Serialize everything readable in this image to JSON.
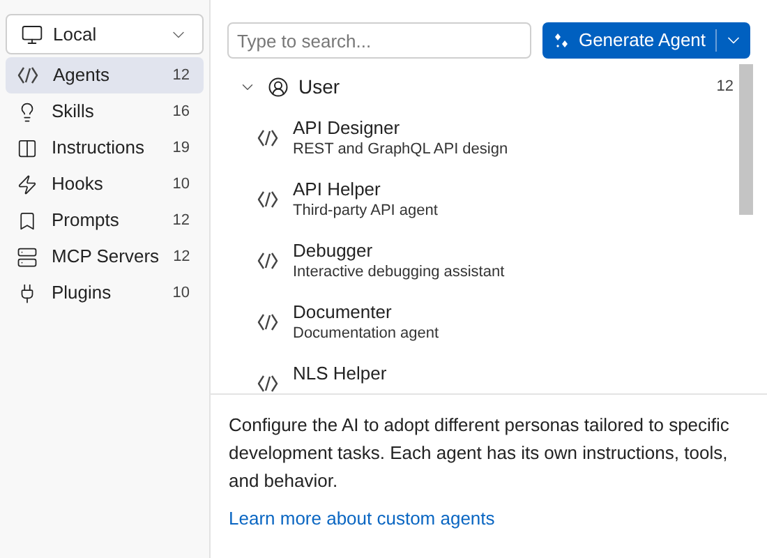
{
  "source_picker": {
    "value": "Local"
  },
  "sidebar": {
    "items": [
      {
        "label": "Agents",
        "count": "12",
        "selected": true
      },
      {
        "label": "Skills",
        "count": "16",
        "selected": false
      },
      {
        "label": "Instructions",
        "count": "19",
        "selected": false
      },
      {
        "label": "Hooks",
        "count": "10",
        "selected": false
      },
      {
        "label": "Prompts",
        "count": "12",
        "selected": false
      },
      {
        "label": "MCP Servers",
        "count": "12",
        "selected": false
      },
      {
        "label": "Plugins",
        "count": "10",
        "selected": false
      }
    ]
  },
  "search": {
    "placeholder": "Type to search..."
  },
  "generate_button": {
    "label": "Generate Agent"
  },
  "group": {
    "label": "User",
    "count": "12",
    "expanded": true,
    "items": [
      {
        "name": "API Designer",
        "description": "REST and GraphQL API design"
      },
      {
        "name": "API Helper",
        "description": "Third-party API agent"
      },
      {
        "name": "Debugger",
        "description": "Interactive debugging assistant"
      },
      {
        "name": "Documenter",
        "description": "Documentation agent"
      },
      {
        "name": "NLS Helper"
      }
    ]
  },
  "info": {
    "text": "Configure the AI to adopt different personas tailored to specific development tasks. Each agent has its own instructions, tools, and behavior.",
    "link": "Learn more about custom agents"
  }
}
